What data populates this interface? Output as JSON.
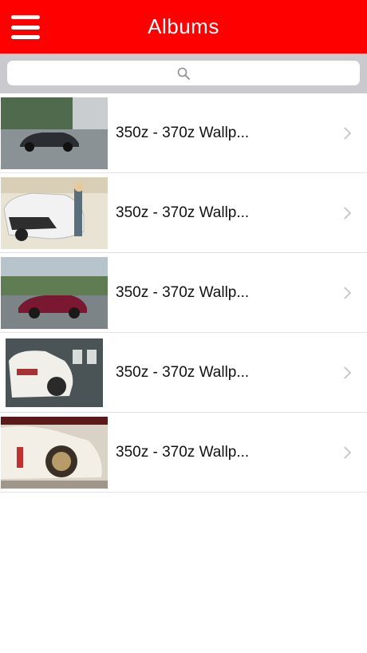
{
  "navbar": {
    "title": "Albums",
    "menu_icon": "hamburger-menu-icon"
  },
  "search": {
    "placeholder": "",
    "icon": "search-icon"
  },
  "albums": [
    {
      "label": "350z - 370z Wallp..."
    },
    {
      "label": "350z - 370z Wallp..."
    },
    {
      "label": "350z - 370z Wallp..."
    },
    {
      "label": "350z - 370z Wallp..."
    },
    {
      "label": "350z - 370z Wallp..."
    }
  ],
  "colors": {
    "navbar_bg": "#ff0000",
    "navbar_text": "#ffffff",
    "search_bg": "#c9c9ce",
    "chevron": "#c7c7cc"
  }
}
